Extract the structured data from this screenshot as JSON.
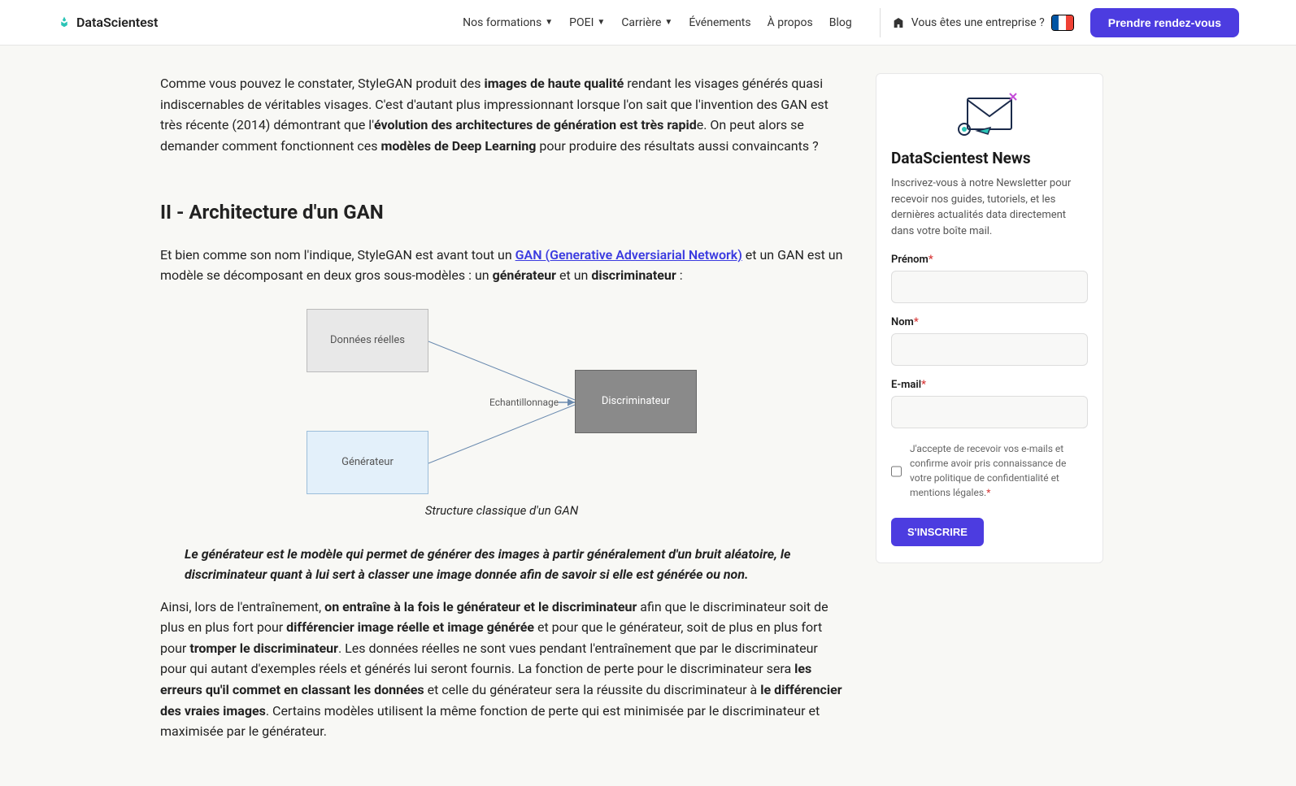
{
  "header": {
    "logo_text": "DataScientest",
    "nav": [
      {
        "label": "Nos formations",
        "dropdown": true
      },
      {
        "label": "POEI",
        "dropdown": true
      },
      {
        "label": "Carrière",
        "dropdown": true
      },
      {
        "label": "Événements",
        "dropdown": false
      },
      {
        "label": "À propos",
        "dropdown": false
      },
      {
        "label": "Blog",
        "dropdown": false
      }
    ],
    "company_link": "Vous êtes une entreprise ?",
    "flag_colors": [
      "#0055a4",
      "#ffffff",
      "#ef4135"
    ],
    "cta": "Prendre rendez-vous"
  },
  "article": {
    "p1_a": "Comme vous pouvez le constater, StyleGAN produit des ",
    "p1_b_strong": "images de haute qualité ",
    "p1_c": "rendant les visages générés quasi indiscernables de véritables visages. C'est d'autant plus impressionnant lorsque l'on sait que l'invention des GAN est très récente (2014) démontrant que l'",
    "p1_d_strong": "évolution des architectures de génération est très rapid",
    "p1_e": "e. On peut alors se demander comment fonctionnent ces ",
    "p1_f_strong": "modèles de Deep Learning",
    "p1_g": " pour produire des résultats aussi convaincants ?",
    "h2": "II - Architecture d'un GAN",
    "p2_a": "Et bien comme son nom l'indique, StyleGAN est avant tout un ",
    "p2_link": "GAN (Generative Adversiarial Network)",
    "p2_b": " et un GAN est un modèle se décomposant en deux gros sous-modèles : un ",
    "p2_c_strong": "générateur",
    "p2_d": " et un ",
    "p2_e_strong": "discriminateur",
    "p2_f": " :",
    "diagram": {
      "real": "Données réelles",
      "gen": "Générateur",
      "disc": "Discriminateur",
      "sampling": "Echantillonnage"
    },
    "caption": "Structure classique d'un GAN",
    "quote": "Le générateur est le modèle qui permet de générer des images à partir généralement d'un bruit aléatoire, le discriminateur quant à lui sert à classer une image donnée afin de savoir si elle est générée ou non.",
    "p3_a": "Ainsi, lors de l'entraînement, ",
    "p3_b_strong": "on entraîne à la fois le générateur et le discriminateur",
    "p3_c": " afin que le discriminateur soit de plus en plus fort pour ",
    "p3_d_strong": "différencier image réelle et image générée",
    "p3_e": " et pour que le générateur, soit de plus en plus fort pour ",
    "p3_f_strong": "tromper le discriminateur",
    "p3_g": ". Les données réelles ne sont vues pendant l'entraînement que par le discriminateur pour qui autant d'exemples réels et générés lui seront fournis. La fonction de perte pour le discriminateur sera ",
    "p3_h_strong": "les erreurs qu'il commet en classant les données",
    "p3_i": " et celle du générateur sera la réussite du discriminateur à ",
    "p3_j_strong": "le différencier des vraies images",
    "p3_k": ". Certains modèles utilisent la même fonction de perte qui est minimisée par le discriminateur et maximisée par le générateur."
  },
  "newsletter": {
    "title": "DataScientest News",
    "desc": "Inscrivez-vous à notre Newsletter pour recevoir nos guides, tutoriels, et les dernières actualités data directement dans votre boîte mail.",
    "fields": {
      "firstname": "Prénom",
      "lastname": "Nom",
      "email": "E-mail"
    },
    "consent": "J'accepte de recevoir vos e-mails et confirme avoir pris connaissance de votre politique de confidentialité et mentions légales.",
    "submit": "S'INSCRIRE"
  }
}
